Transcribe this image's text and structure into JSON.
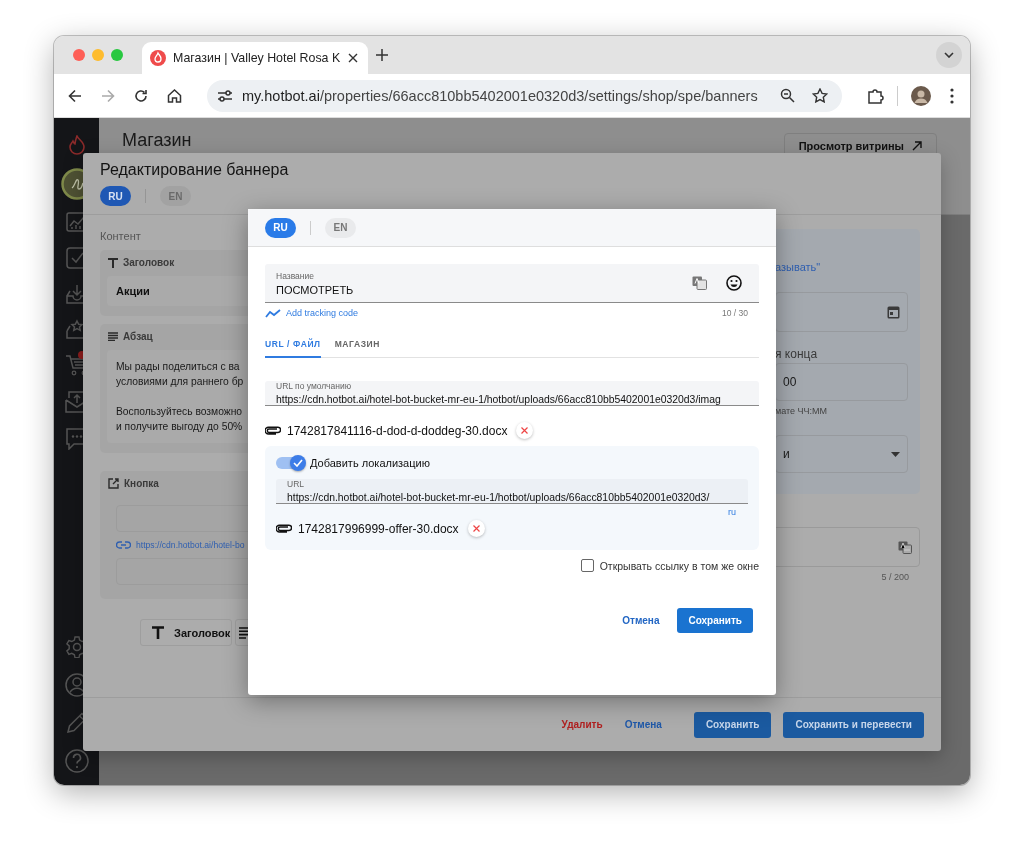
{
  "browser": {
    "tab_title": "Магазин | Valley Hotel Rosa K",
    "url_host": "my.hotbot.ai",
    "url_path": "/properties/66acc810bb5402001e0320d3/settings/shop/spe/banners"
  },
  "page": {
    "title": "Магазин",
    "storefront_button": "Просмотр витрины"
  },
  "banner_editor": {
    "title": "Редактирование баннера",
    "languages": [
      {
        "label": "RU",
        "selected": true
      },
      {
        "label": "EN",
        "selected": false
      }
    ],
    "content_label": "Контент",
    "blocks": [
      {
        "kind": "heading",
        "label": "Заголовок",
        "value": "Акции"
      },
      {
        "kind": "paragraph",
        "label": "Абзац",
        "paragraphs": [
          [
            "Мы рады поделиться с ва",
            "условиями для раннего бр"
          ],
          [
            "Воспользуйтесь возможно",
            "и получите выгоду до 50%"
          ]
        ]
      },
      {
        "kind": "button",
        "label": "Кнопка",
        "link": "https://cdn.hotbot.ai/hotel-bo"
      }
    ],
    "add_buttons": [
      {
        "kind": "heading",
        "label": "Заголовок"
      },
      {
        "kind": "paragraph"
      }
    ],
    "settings": {
      "link_text": "азывать\"",
      "end_time_label": "я конца",
      "end_time_value": "00",
      "time_hint": "мате ЧЧ:ММ",
      "select_value": "и",
      "counter": "5 / 200"
    },
    "footer": {
      "delete": "Удалить",
      "cancel": "Отмена",
      "save": "Сохранить",
      "save_translate": "Сохранить и перевести"
    }
  },
  "button_dialog": {
    "languages": [
      {
        "label": "RU",
        "selected": true
      },
      {
        "label": "EN",
        "selected": false
      }
    ],
    "name_field": {
      "label": "Название",
      "value": "ПОСМОТРЕТЬ",
      "counter": "10 / 30"
    },
    "tracking_link": "Add tracking code",
    "tabs": [
      {
        "label": "URL / ФАЙЛ",
        "selected": true
      },
      {
        "label": "МАГАЗИН",
        "selected": false
      }
    ],
    "url_field": {
      "label": "URL по умолчанию",
      "value": "https://cdn.hotbot.ai/hotel-bot-bucket-mr-eu-1/hotbot/uploads/66acc810bb5402001e0320d3/imag"
    },
    "attachment": "1742817841116-d-dod-d-doddeg-30.docx",
    "localization": {
      "label": "Добавить локализацию",
      "on": true,
      "url_label": "URL",
      "url_value": "https://cdn.hotbot.ai/hotel-bot-bucket-mr-eu-1/hotbot/uploads/66acc810bb5402001e0320d3/",
      "locale": "ru",
      "attachment": "1742817996999-offer-30.docx"
    },
    "same_window": {
      "label": "Открывать ссылку в том же окне",
      "checked": false
    },
    "cancel": "Отмена",
    "save": "Сохранить"
  }
}
